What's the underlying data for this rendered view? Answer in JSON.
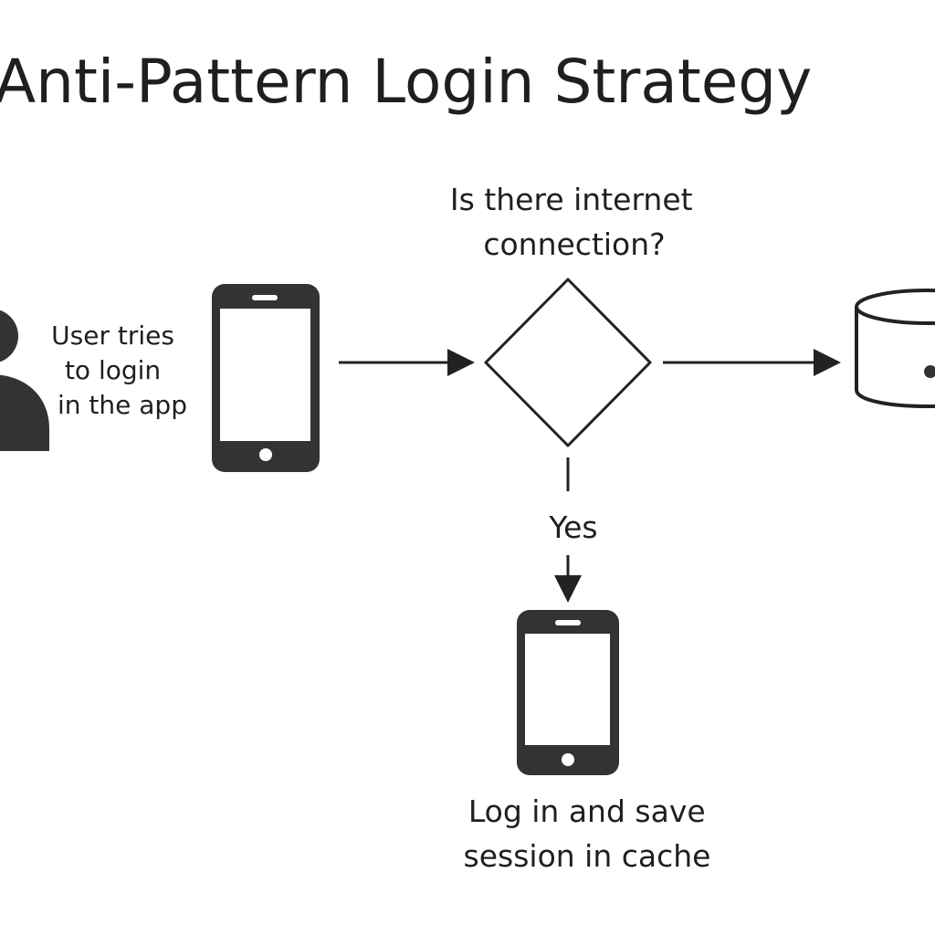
{
  "title": "Anti-Pattern Login Strategy",
  "user": {
    "icon": "user-icon",
    "label_lines": [
      "User tries",
      "to login",
      "in the app"
    ]
  },
  "phone_top": {
    "icon": "smartphone-icon"
  },
  "decision": {
    "question_lines": [
      "Is there internet",
      "connection?"
    ],
    "yes_label": "Yes"
  },
  "database": {
    "icon": "database-icon"
  },
  "phone_bottom": {
    "icon": "smartphone-icon",
    "label_lines": [
      "Log in and save",
      "session in cache"
    ]
  },
  "colors": {
    "ink": "#222222",
    "icon_fill": "#333333",
    "background": "#ffffff"
  }
}
